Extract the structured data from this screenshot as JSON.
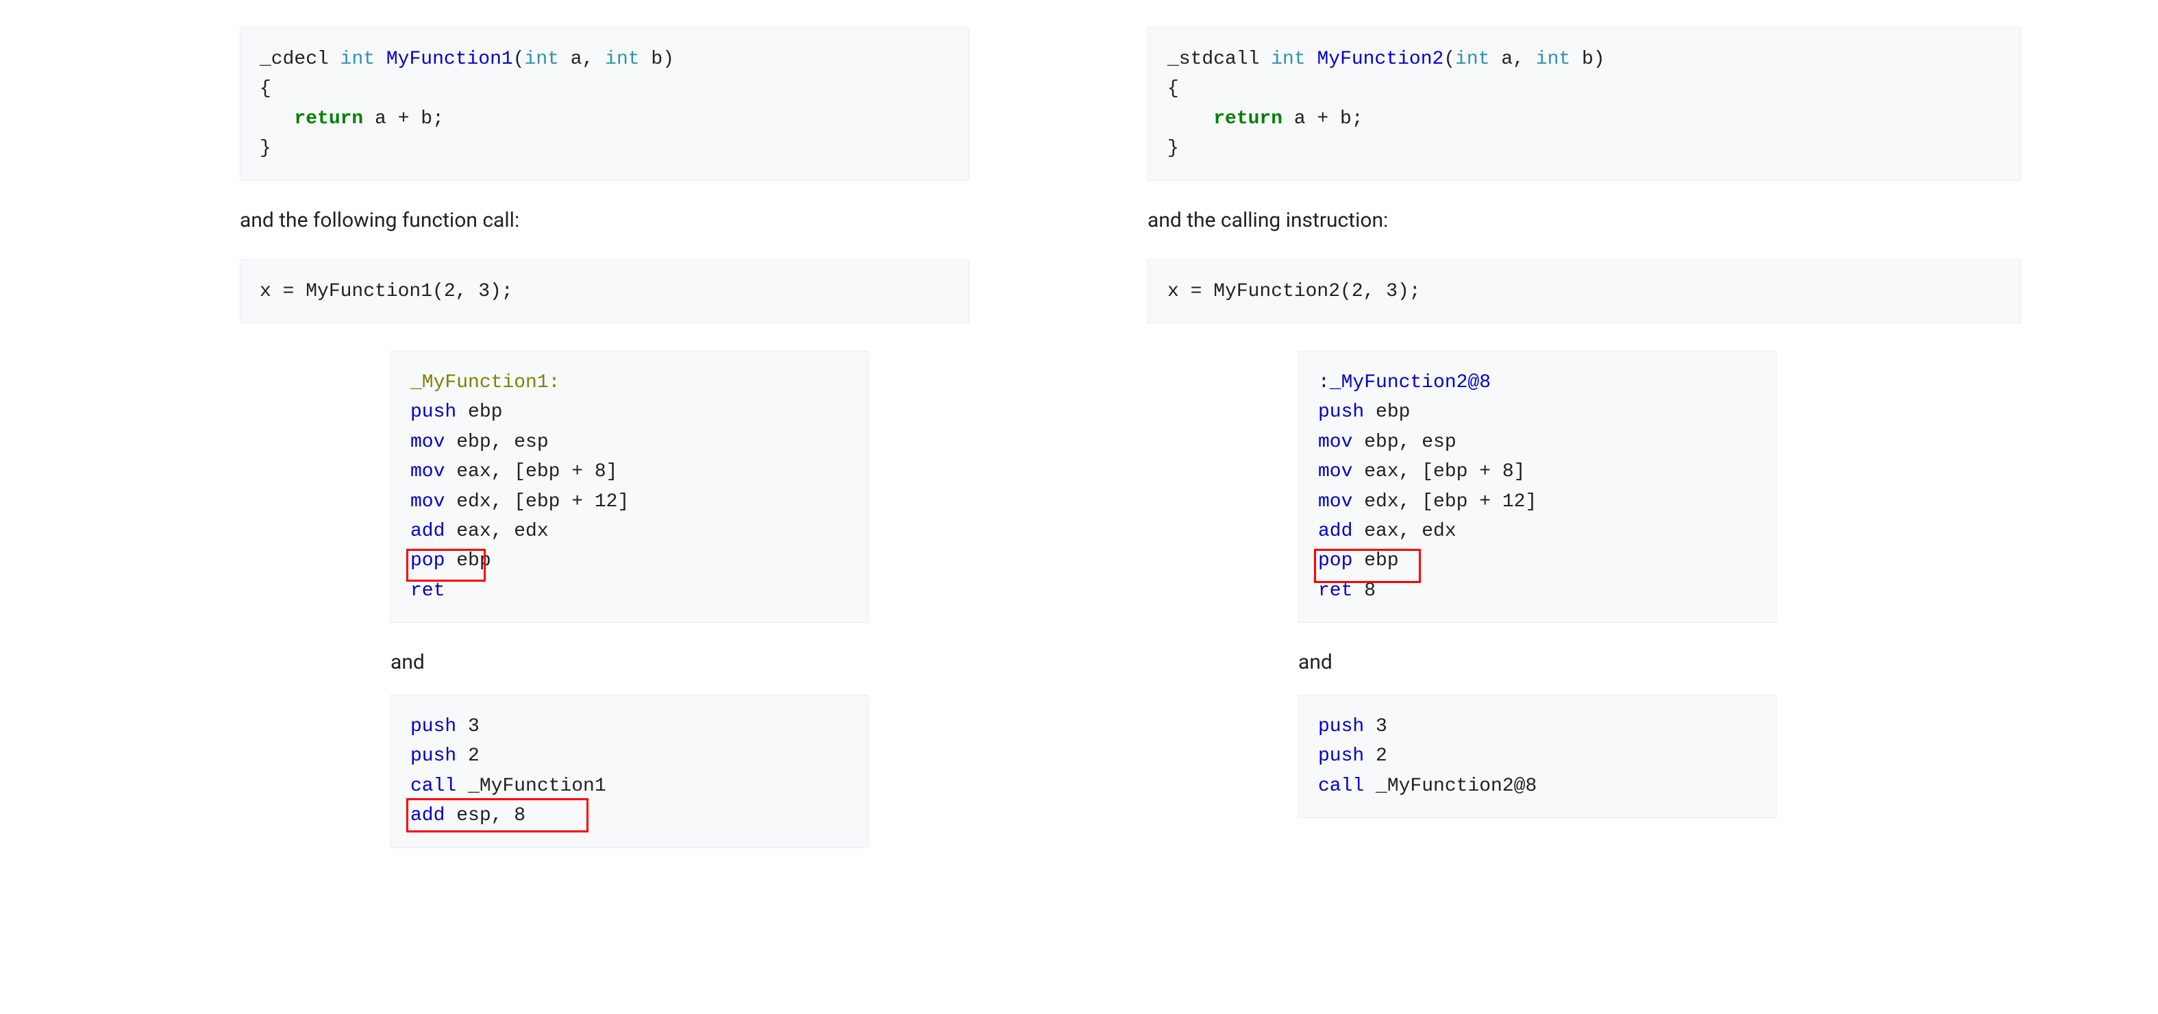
{
  "left": {
    "defn": {
      "decl_prefix": "_cdecl",
      "ret_type": "int",
      "fn_name": "MyFunction1",
      "params_open": "(",
      "p1_type": "int",
      "p1_name": " a",
      "comma": ",",
      "p2_type": " int",
      "p2_name": " b",
      "params_close": ")",
      "brace_open": "{",
      "indent": "   ",
      "ret_kw": "return",
      "ret_expr": " a + b;",
      "brace_close": "}"
    },
    "caption1": "and the following function call:",
    "call_code": "x = MyFunction1(2, 3);",
    "asm1": {
      "label": "_MyFunction1:",
      "l1a": "push",
      "l1b": " ebp",
      "l2a": "mov",
      "l2b": " ebp, esp",
      "l3a": "mov",
      "l3b": " eax, [ebp + 8]",
      "l4a": "mov",
      "l4b": " edx, [ebp + 12]",
      "l5a": "add",
      "l5b": " eax, edx",
      "l6a": "pop",
      "l6b": " ebp",
      "l7a": "ret"
    },
    "and": "and",
    "asm2": {
      "l1a": "push",
      "l1b": " 3",
      "l2a": "push",
      "l2b": " 2",
      "l3a": "call",
      "l3b": " _MyFunction1",
      "l4a": "add",
      "l4b": " esp, 8"
    },
    "red1_label": "ret highlight",
    "red2_label": "add esp highlight"
  },
  "right": {
    "defn": {
      "decl_prefix": "_stdcall",
      "ret_type": "int",
      "fn_name": "MyFunction2",
      "params_open": "(",
      "p1_type": "int",
      "p1_name": " a",
      "comma": ",",
      "p2_type": " int",
      "p2_name": " b",
      "params_close": ")",
      "brace_open": "{",
      "indent": "    ",
      "ret_kw": "return",
      "ret_expr": " a + b;",
      "brace_close": "}"
    },
    "caption1": "and the calling instruction:",
    "call_code": "x = MyFunction2(2, 3);",
    "asm1": {
      "label": ":_MyFunction2@8",
      "l1a": "push",
      "l1b": " ebp",
      "l2a": "mov",
      "l2b": " ebp, esp",
      "l3a": "mov",
      "l3b": " eax, [ebp + 8]",
      "l4a": "mov",
      "l4b": " edx, [ebp + 12]",
      "l5a": "add",
      "l5b": " eax, edx",
      "l6a": "pop",
      "l6b": " ebp",
      "l7a": "ret",
      "l7b": " 8"
    },
    "and": "and",
    "asm2": {
      "l1a": "push",
      "l1b": " 3",
      "l2a": "push",
      "l2b": " 2",
      "l3a": "call",
      "l3b": " _MyFunction2@8"
    },
    "red1_label": "ret 8 highlight"
  }
}
